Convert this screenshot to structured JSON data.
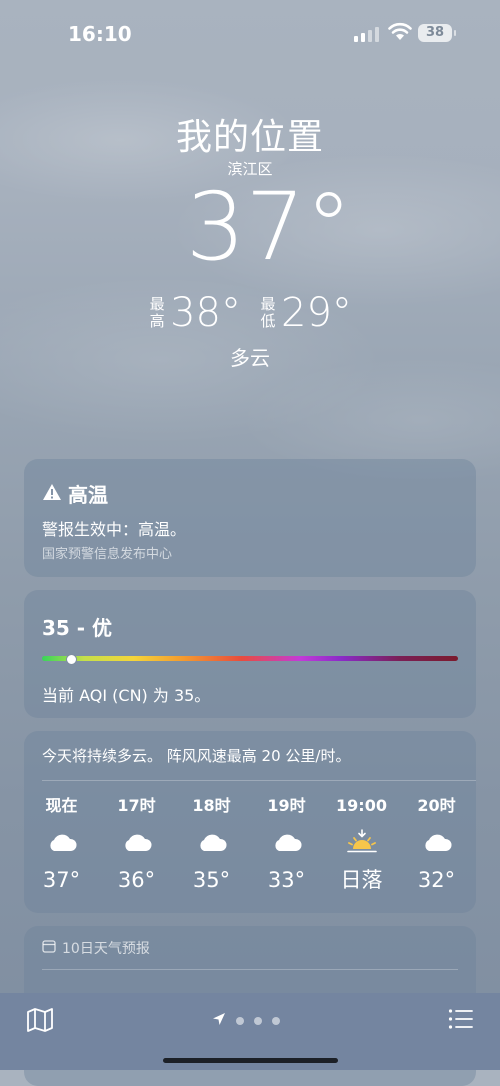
{
  "status_bar": {
    "time": "16:10",
    "battery": "38"
  },
  "location": {
    "title": "我的位置",
    "subtitle": "滨江区"
  },
  "current": {
    "temperature": "37°",
    "high_label": "最高",
    "high": "38°",
    "low_label": "最低",
    "low": "29°",
    "condition": "多云"
  },
  "alert_card": {
    "title": "高温",
    "message": "警报生效中：高温。",
    "source": "国家预警信息发布中心"
  },
  "aqi_card": {
    "title": "35 - 优",
    "description": "当前 AQI (CN) 为 35。",
    "level_fraction": 0.07
  },
  "hourly_card": {
    "summary": "今天将持续多云。 阵风风速最高 20 公里/时。",
    "hours": [
      {
        "label": "现在",
        "icon": "cloud-icon",
        "temp": "37°"
      },
      {
        "label": "17时",
        "icon": "cloud-icon",
        "temp": "36°"
      },
      {
        "label": "18时",
        "icon": "cloud-icon",
        "temp": "35°"
      },
      {
        "label": "19时",
        "icon": "cloud-icon",
        "temp": "33°"
      },
      {
        "label": "19:00",
        "icon": "sunset-icon",
        "temp": "日落"
      },
      {
        "label": "20时",
        "icon": "cloud-icon",
        "temp": "32°"
      }
    ]
  },
  "forecast_card": {
    "title": "10日天气预报"
  },
  "toolbar": {
    "page_count": 3
  }
}
